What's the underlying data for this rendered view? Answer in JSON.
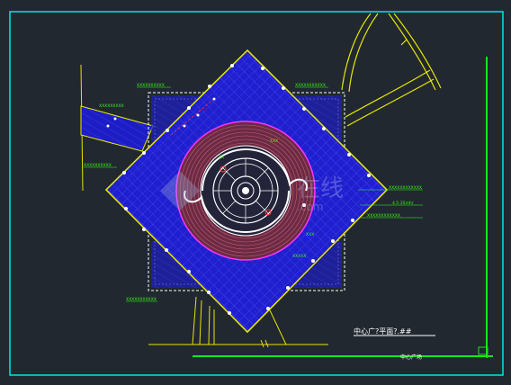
{
  "drawing": {
    "plan_title": "中心广?平面?.##",
    "sheet_label": "中心广场",
    "watermark_text": "在线",
    "watermark_domain": ".com",
    "annotations": [
      "XXXXXXXXXX",
      "XXXXXXXXXXX",
      "XXXXXXXXX",
      "XXXXXXXXXX",
      "XXXXXXXXXXXX",
      "4.5-35mhr",
      "XXXXXXXXXXXX",
      "XXXXXXXXXXX",
      "XXXXX",
      "XXX",
      "XX",
      "XXX"
    ]
  },
  "colors": {
    "background": "#212830",
    "frame": "#00e5e5",
    "plaza_fill": "#1f1fcf",
    "outline": "#e6e600",
    "ring_fill": "#6b2a45",
    "ring_edge": "#ff33ff",
    "text": "#39ff14",
    "white": "#ffffff"
  }
}
